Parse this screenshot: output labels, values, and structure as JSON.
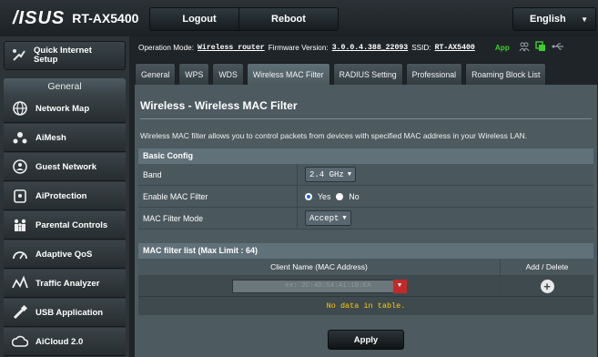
{
  "header": {
    "logo": "/ISUS",
    "model": "RT-AX5400",
    "logout_label": "Logout",
    "reboot_label": "Reboot",
    "language": "English"
  },
  "sidebar": {
    "quick_setup": "Quick Internet Setup",
    "section": "General",
    "items": [
      {
        "label": "Network Map",
        "icon": "network-map-icon"
      },
      {
        "label": "AiMesh",
        "icon": "aimesh-icon"
      },
      {
        "label": "Guest Network",
        "icon": "guest-network-icon"
      },
      {
        "label": "AiProtection",
        "icon": "aiprotection-icon"
      },
      {
        "label": "Parental Controls",
        "icon": "parental-controls-icon"
      },
      {
        "label": "Adaptive QoS",
        "icon": "adaptive-qos-icon"
      },
      {
        "label": "Traffic Analyzer",
        "icon": "traffic-analyzer-icon"
      },
      {
        "label": "USB Application",
        "icon": "usb-application-icon"
      },
      {
        "label": "AiCloud 2.0",
        "icon": "aicloud-icon"
      }
    ]
  },
  "status": {
    "op_mode_label": "Operation Mode:",
    "op_mode": "Wireless router",
    "fw_label": "Firmware Version:",
    "fw": "3.0.0.4.388_22093",
    "ssid_label": "SSID:",
    "ssid": "RT-AX5400",
    "app": "App"
  },
  "tabs": [
    "General",
    "WPS",
    "WDS",
    "Wireless MAC Filter",
    "RADIUS Setting",
    "Professional",
    "Roaming Block List"
  ],
  "page": {
    "title": "Wireless - Wireless MAC Filter",
    "description": "Wireless MAC filter allows you to control packets from devices with specified MAC address in your Wireless LAN."
  },
  "basic_config": {
    "heading": "Basic Config",
    "band_label": "Band",
    "band_value": "2.4 GHz",
    "enable_label": "Enable MAC Filter",
    "yes_label": "Yes",
    "no_label": "No",
    "mode_label": "MAC Filter Mode",
    "mode_value": "Accept"
  },
  "mac_list": {
    "heading": "MAC filter list (Max Limit : 64)",
    "col_client": "Client Name (MAC Address)",
    "col_action": "Add / Delete",
    "input_placeholder": "ex: 2C:4D:54:A1:1B:EA",
    "empty": "No data in table."
  },
  "apply_label": "Apply",
  "colors": {
    "accent_green": "#3ccf2a",
    "dropdown_red": "#c12a2a",
    "empty_text": "#ffcc00"
  }
}
